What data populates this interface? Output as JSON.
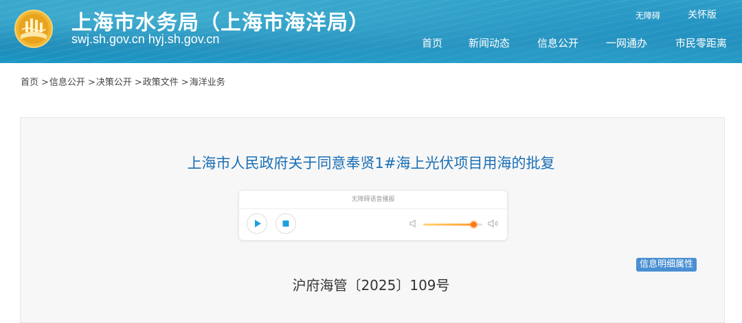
{
  "header": {
    "site_title": "上海市水务局（上海市海洋局）",
    "site_domains": "swj.sh.gov.cn  hyj.sh.gov.cn",
    "util_links": {
      "accessibility": "无障碍",
      "care_version": "关怀版"
    },
    "nav": [
      "首页",
      "新闻动态",
      "信息公开",
      "一网通办",
      "市民零距离"
    ]
  },
  "breadcrumb": [
    "首页",
    "信息公开",
    "决策公开",
    "政策文件",
    "海洋业务"
  ],
  "article": {
    "title": "上海市人民政府关于同意奉贤1#海上光伏项目用海的批复",
    "doc_number": "沪府海管〔2025〕109号",
    "info_badge": "信息明细属性"
  },
  "player": {
    "header": "无障碍语音播报",
    "volume": 0.85,
    "icons": [
      "play-icon",
      "stop-icon",
      "volume-mute-icon",
      "volume-max-icon"
    ]
  },
  "colors": {
    "header_blue": "#1e8fbf",
    "title_blue": "#1a6fb5",
    "badge_blue": "#4a8fd3",
    "accent_orange": "#ff7a12"
  }
}
